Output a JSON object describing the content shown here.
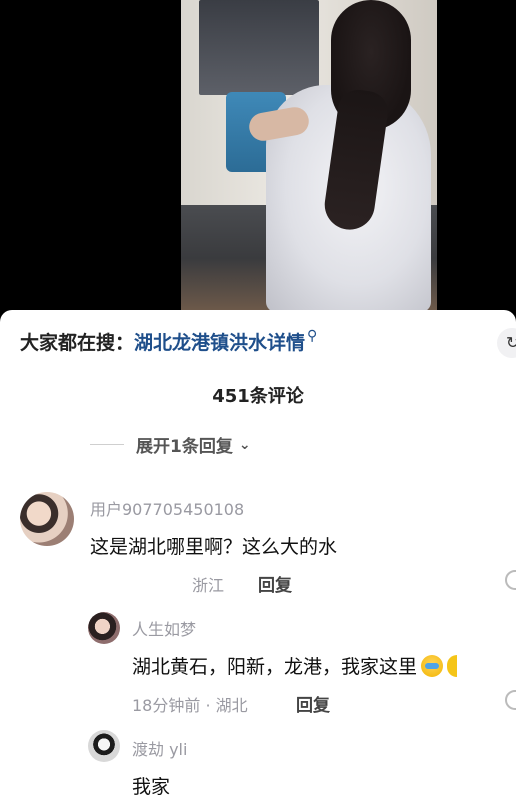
{
  "search": {
    "prefix": "大家都在搜：",
    "query": "湖北龙港镇洪水详情",
    "icon": "search-icon"
  },
  "comment_count": "451条评论",
  "expand_label": "展开1条回复",
  "comments": [
    {
      "username": "用户907705450108",
      "text": "这是湖北哪里啊？这么大的水",
      "location": "浙江",
      "reply_label": "回复"
    },
    {
      "username": "人生如梦",
      "text": "湖北黄石，阳新，龙港，我家这里",
      "meta": "18分钟前 · 湖北",
      "reply_label": "回复"
    },
    {
      "username": "渡劫 yli",
      "text": "我家"
    }
  ],
  "edge_button_icon": "share-icon"
}
